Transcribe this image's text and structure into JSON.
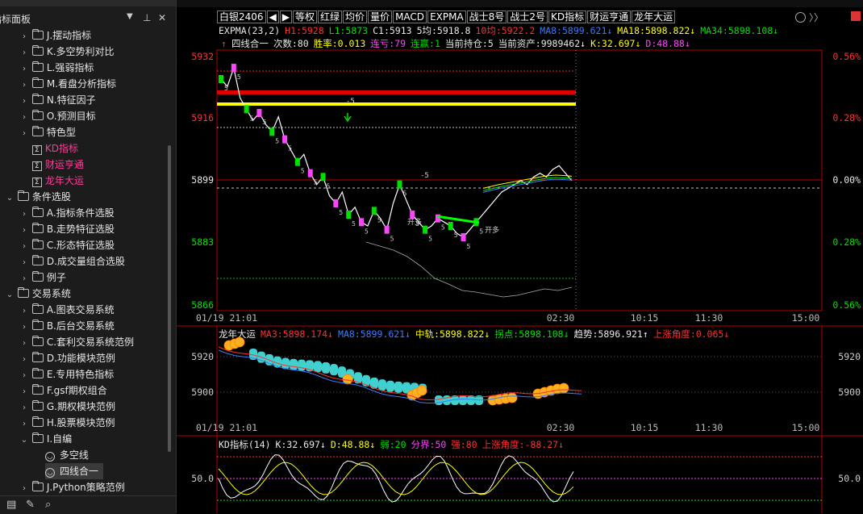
{
  "colors": {
    "red": "#ff3030",
    "yellow": "#ffff00",
    "green": "#00e000",
    "white": "#e8e8e8",
    "blue": "#3a7bff",
    "magenta": "#ff44ff",
    "cyan": "#40e0e0",
    "pink": "#ff3b9a",
    "axis_red": "#b00000"
  },
  "left_panel": {
    "title": "指标面板",
    "pin_icon": "pin-icon",
    "close_label": "✕",
    "items": [
      {
        "label": "J.摆动指标",
        "type": "folder",
        "level": 2
      },
      {
        "label": "K.多空势利对比",
        "type": "folder",
        "level": 2
      },
      {
        "label": "L.强弱指标",
        "type": "folder",
        "level": 2
      },
      {
        "label": "M.看盘分析指标",
        "type": "folder",
        "level": 2
      },
      {
        "label": "N.特征因子",
        "type": "folder",
        "level": 2
      },
      {
        "label": "O.预测目标",
        "type": "folder",
        "level": 2
      },
      {
        "label": "特色型",
        "type": "folder",
        "level": 2
      },
      {
        "label": "KD指标",
        "type": "formula",
        "level": 2,
        "pink": true
      },
      {
        "label": "财运亨通",
        "type": "formula",
        "level": 2,
        "pink": true
      },
      {
        "label": "龙年大运",
        "type": "formula",
        "level": 2,
        "pink": true
      },
      {
        "label": "条件选股",
        "type": "folder",
        "level": 1,
        "expanded": true
      },
      {
        "label": "A.指标条件选股",
        "type": "folder",
        "level": 2
      },
      {
        "label": "B.走势特征选股",
        "type": "folder",
        "level": 2
      },
      {
        "label": "C.形态特征选股",
        "type": "folder",
        "level": 2
      },
      {
        "label": "D.成交量组合选股",
        "type": "folder",
        "level": 2
      },
      {
        "label": "例子",
        "type": "folder",
        "level": 2
      },
      {
        "label": "交易系统",
        "type": "folder",
        "level": 1,
        "expanded": true
      },
      {
        "label": "A.图表交易系统",
        "type": "folder",
        "level": 2
      },
      {
        "label": "B.后台交易系统",
        "type": "folder",
        "level": 2
      },
      {
        "label": "C.套利交易系统范例",
        "type": "folder",
        "level": 2
      },
      {
        "label": "D.功能模块范例",
        "type": "folder",
        "level": 2
      },
      {
        "label": "E.专用特色指标",
        "type": "folder",
        "level": 2
      },
      {
        "label": "F.gsf期权组合",
        "type": "folder",
        "level": 2
      },
      {
        "label": "G.期权模块范例",
        "type": "folder",
        "level": 2
      },
      {
        "label": "H.股票模块范例",
        "type": "folder",
        "level": 2
      },
      {
        "label": "I.自编",
        "type": "folder",
        "level": 2,
        "expanded": true
      },
      {
        "label": "多空线",
        "type": "smile",
        "level": 3
      },
      {
        "label": "四线合一",
        "type": "smile",
        "level": 3,
        "selected": true
      },
      {
        "label": "J.Python策略范例",
        "type": "folder",
        "level": 2
      }
    ],
    "bottom_icons": [
      "edit-icon",
      "search-icon"
    ]
  },
  "toolbar": {
    "items": [
      "白银2406",
      "◀",
      "▶",
      "等权",
      "红绿",
      "均价",
      "量价",
      "MACD",
      "EXPMA",
      "战士8号",
      "战士2号",
      "KD指标",
      "财运亨通",
      "龙年大运"
    ]
  },
  "main_panel": {
    "expma_line": [
      {
        "t": "EXPMA(23,2)",
        "c": "#e8e8e8"
      },
      {
        "t": "H1:5928",
        "c": "#ff3030"
      },
      {
        "t": "L1:5873",
        "c": "#00e000"
      },
      {
        "t": "C1:5913",
        "c": "#e8e8e8"
      },
      {
        "t": "5均:5918.8",
        "c": "#e8e8e8"
      },
      {
        "t": "10均:5922.2",
        "c": "#ff3030"
      },
      {
        "t": "MA8:5899.621↓",
        "c": "#3a7bff"
      },
      {
        "t": "MA18:5898.822↓",
        "c": "#ffff00"
      },
      {
        "t": "MA34:5898.108↓",
        "c": "#00e000"
      }
    ],
    "strategy_line": [
      {
        "t": "↑",
        "c": "#ff3030"
      },
      {
        "t": "四线合一",
        "c": "#e8e8e8"
      },
      {
        "t": "次数:80",
        "c": "#e8e8e8"
      },
      {
        "t": "胜率:0.013",
        "c": "#ffff00"
      },
      {
        "t": "连亏:79",
        "c": "#ff44ff"
      },
      {
        "t": "连赢:1",
        "c": "#00e000"
      },
      {
        "t": "当前持仓:5",
        "c": "#e8e8e8"
      },
      {
        "t": "当前资产:9989462↓",
        "c": "#e8e8e8"
      },
      {
        "t": "K:32.697↓",
        "c": "#ffff00"
      },
      {
        "t": "D:48.88↓",
        "c": "#ff44ff"
      }
    ],
    "y_labels": [
      "5932",
      "5916",
      "5899",
      "5883",
      "5866"
    ],
    "pct_labels": [
      "0.56%",
      "0.28%",
      "0.00%",
      "0.28%",
      "0.56%"
    ],
    "x_labels": [
      "01/19 21:01",
      "02:30",
      "10:15",
      "11:30",
      "15:00"
    ]
  },
  "panel2": {
    "title_line": [
      {
        "t": "龙年大运",
        "c": "#e8e8e8"
      },
      {
        "t": "MA3:5898.174↓",
        "c": "#ff3030"
      },
      {
        "t": "MA8:5899.621↓",
        "c": "#3a7bff"
      },
      {
        "t": "中轨:5898.822↓",
        "c": "#ffff00"
      },
      {
        "t": "拐点:5898.108↓",
        "c": "#00e000"
      },
      {
        "t": "趋势:5896.921↑",
        "c": "#e8e8e8"
      },
      {
        "t": "上涨角度:0.065↓",
        "c": "#ff3030"
      }
    ],
    "y_labels": [
      "5920",
      "5900"
    ],
    "x_labels": [
      "01/19 21:01",
      "02:30",
      "10:15",
      "11:30",
      "15:00"
    ]
  },
  "panel3": {
    "title_line": [
      {
        "t": "KD指标(14)",
        "c": "#e8e8e8"
      },
      {
        "t": "K:32.697↓",
        "c": "#e8e8e8"
      },
      {
        "t": "D:48.88↓",
        "c": "#ffff00"
      },
      {
        "t": "弱:20",
        "c": "#00e000"
      },
      {
        "t": "分界:50",
        "c": "#ff44ff"
      },
      {
        "t": "强:80",
        "c": "#ff3030"
      },
      {
        "t": "上涨角度:-88.27↓",
        "c": "#ff3030"
      }
    ],
    "y_labels": [
      "50.0"
    ]
  }
}
